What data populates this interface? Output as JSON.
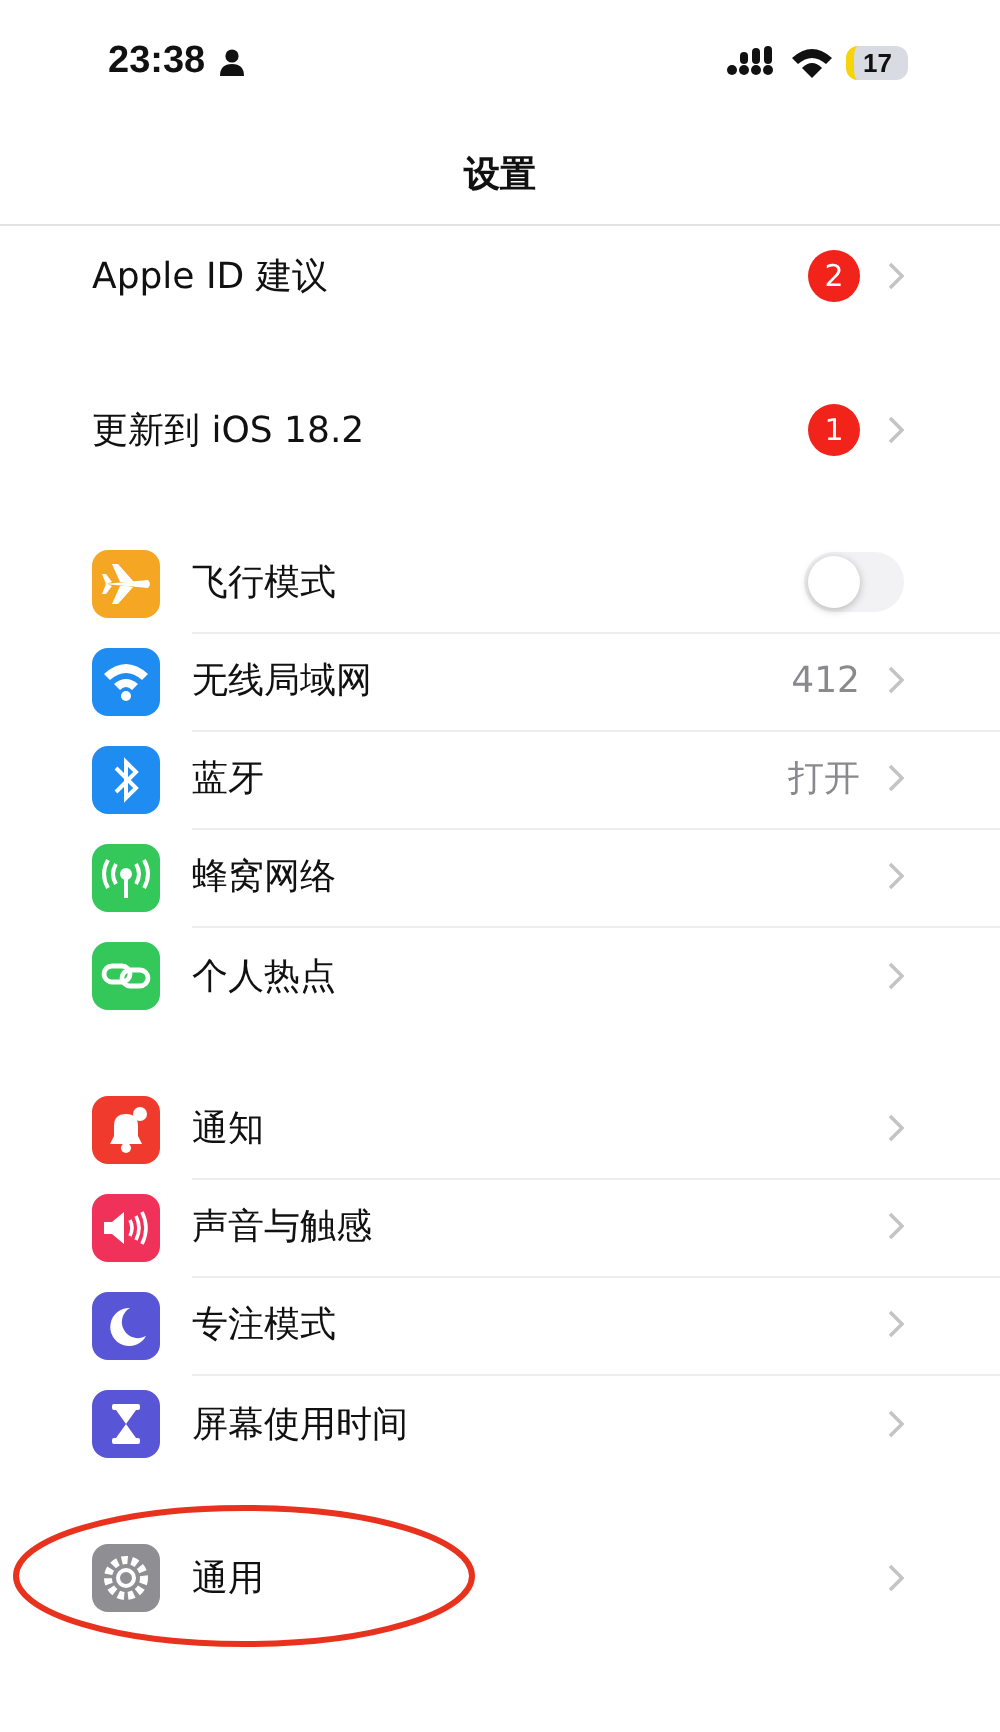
{
  "status_bar": {
    "time": "23:38",
    "battery": "17"
  },
  "title": "设置",
  "sections": [
    {
      "rows": [
        {
          "label": "Apple ID 建议",
          "kind": "badge",
          "badge": "2"
        }
      ]
    },
    {
      "rows": [
        {
          "label": "更新到 iOS 18.2",
          "kind": "badge",
          "badge": "1"
        }
      ]
    },
    {
      "rows": [
        {
          "label": "飞行模式",
          "kind": "toggle",
          "on": false,
          "color": "#f5a623"
        },
        {
          "label": "无线局域网",
          "kind": "value",
          "value": "412",
          "color": "#1e8cf0"
        },
        {
          "label": "蓝牙",
          "kind": "value",
          "value": "打开",
          "color": "#1e8cf0"
        },
        {
          "label": "蜂窝网络",
          "kind": "plain",
          "color": "#34c759"
        },
        {
          "label": "个人热点",
          "kind": "plain",
          "color": "#34c759"
        }
      ]
    },
    {
      "rows": [
        {
          "label": "通知",
          "kind": "plain",
          "color": "#f03a2e"
        },
        {
          "label": "声音与触感",
          "kind": "plain",
          "color": "#f0325a"
        },
        {
          "label": "专注模式",
          "kind": "plain",
          "color": "#5856d6"
        },
        {
          "label": "屏幕使用时间",
          "kind": "plain",
          "color": "#5856d6"
        }
      ]
    },
    {
      "circled": true,
      "rows": [
        {
          "label": "通用",
          "kind": "plain",
          "color": "#8e8e93"
        }
      ]
    }
  ]
}
